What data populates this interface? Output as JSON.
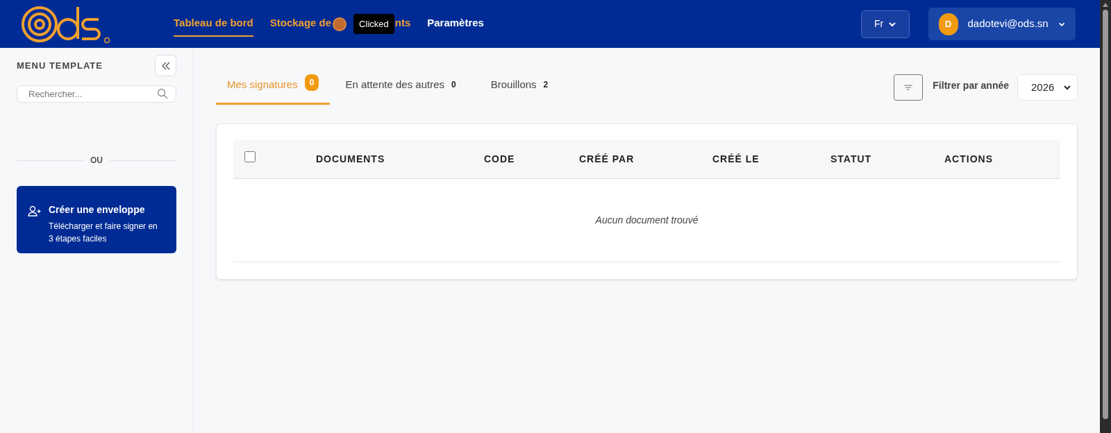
{
  "header": {
    "nav": [
      {
        "label": "Tableau de bord",
        "selected": true
      },
      {
        "label": "Stockage de",
        "label_tail": "nts",
        "selected": false
      },
      {
        "label": "Paramètres",
        "selected": false
      }
    ],
    "click_tooltip": "Clicked",
    "language": "Fr",
    "user": {
      "initial": "D",
      "email": "dadotevi@ods.sn"
    }
  },
  "sidebar": {
    "title": "MENU TEMPLATE",
    "search": {
      "placeholder": "Rechercher..."
    },
    "separator": "OU",
    "create_card": {
      "title": "Créer une enveloppe",
      "description": "Télécharger et faire signer en 3 étapes faciles"
    }
  },
  "tabs": [
    {
      "label": "Mes signatures",
      "count": "0",
      "selected": true
    },
    {
      "label": "En attente des autres",
      "count": "0",
      "selected": false
    },
    {
      "label": "Brouillons",
      "count": "2",
      "selected": false
    }
  ],
  "filter": {
    "label": "Filtrer par année",
    "year": "2026"
  },
  "table": {
    "select_all_checked": false,
    "columns": [
      "DOCUMENTS",
      "CODE",
      "CRÉÉ PAR",
      "CRÉÉ LE",
      "STATUT",
      "ACTIONS"
    ],
    "empty_message": "Aucun document trouvé"
  }
}
